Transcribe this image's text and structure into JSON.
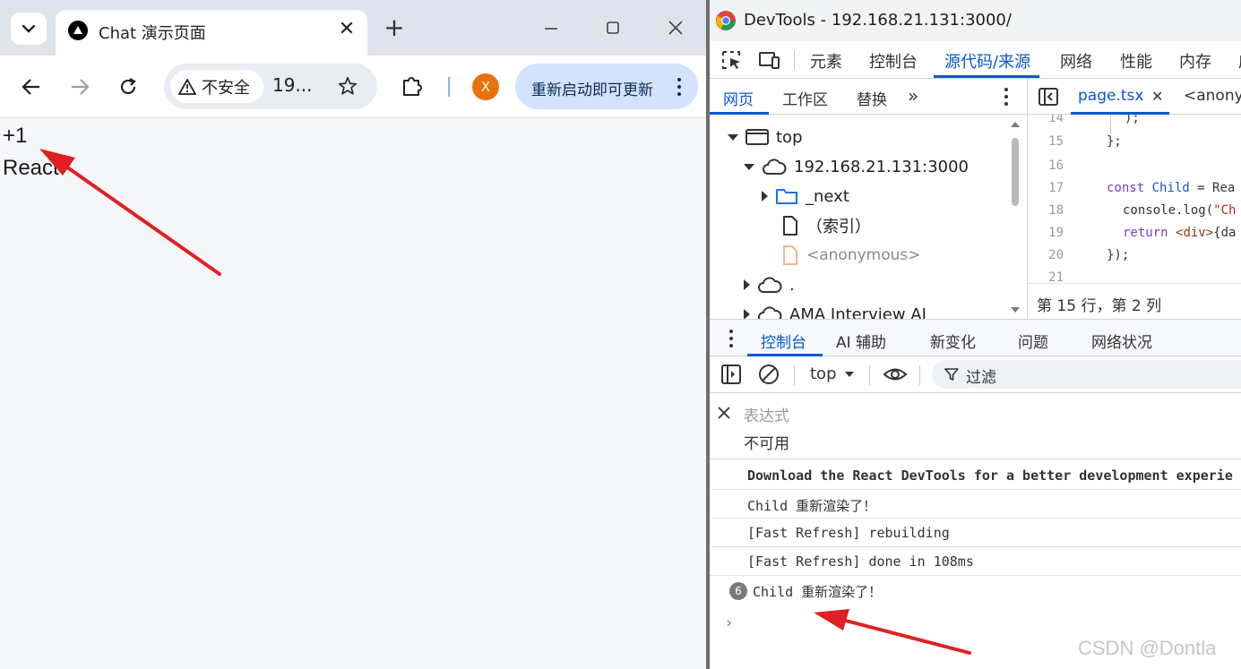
{
  "browser": {
    "tab": {
      "title": "Chat 演示页面"
    },
    "omnibox": {
      "security_label": "不安全",
      "url": "19..."
    },
    "profile_initial": "X",
    "update_button_label": "重新启动即可更新",
    "page": {
      "lines": [
        "+1",
        "React"
      ]
    }
  },
  "devtools": {
    "window_title": "DevTools - 192.168.21.131:3000/",
    "main_tabs": [
      "元素",
      "控制台",
      "源代码/来源",
      "网络",
      "性能",
      "内存",
      "应"
    ],
    "active_main_tab": "源代码/来源",
    "source_tabs": [
      "网页",
      "工作区",
      "替换"
    ],
    "file_tree": {
      "top": "top",
      "origin": "192.168.21.131:3000",
      "folder": "_next",
      "index": "（索引）",
      "anonymous": "<anonymous>",
      "dot": ".",
      "ama": "AMA Interview AI"
    },
    "editor": {
      "tabs": [
        "page.tsx",
        "<anony"
      ],
      "lines": [
        {
          "n": "14",
          "text": ");"
        },
        {
          "n": "15",
          "text": "};"
        },
        {
          "n": "16",
          "text": ""
        },
        {
          "n": "17",
          "kw": "const",
          "name": "Child",
          "rest": " = Rea"
        },
        {
          "n": "18",
          "call": "console.log(",
          "str": "\"Ch"
        },
        {
          "n": "19",
          "kw": "return",
          "tag": "<div>",
          "rest": "{da"
        },
        {
          "n": "20",
          "text": "});"
        },
        {
          "n": "21",
          "text": ""
        }
      ],
      "status": "第 15 行，第 2 列"
    },
    "drawer_tabs": [
      "控制台",
      "AI 辅助",
      "新变化",
      "问题",
      "网络状况"
    ],
    "console": {
      "context": "top",
      "filter_label": "过滤",
      "expression_placeholder": "表达式",
      "expression_value": "不可用",
      "messages": [
        "Download the React DevTools for a better development experie",
        "Child 重新渲染了！",
        "[Fast Refresh] rebuilding",
        "[Fast Refresh] done in 108ms"
      ],
      "grouped_message": {
        "count": "6",
        "text": "Child 重新渲染了！"
      },
      "prompt": "›"
    }
  },
  "watermark": "CSDN @Dontla",
  "colors": {
    "accent": "#0b57d0",
    "annotation_arrow": "#e02020",
    "profile": "#e8710a"
  }
}
